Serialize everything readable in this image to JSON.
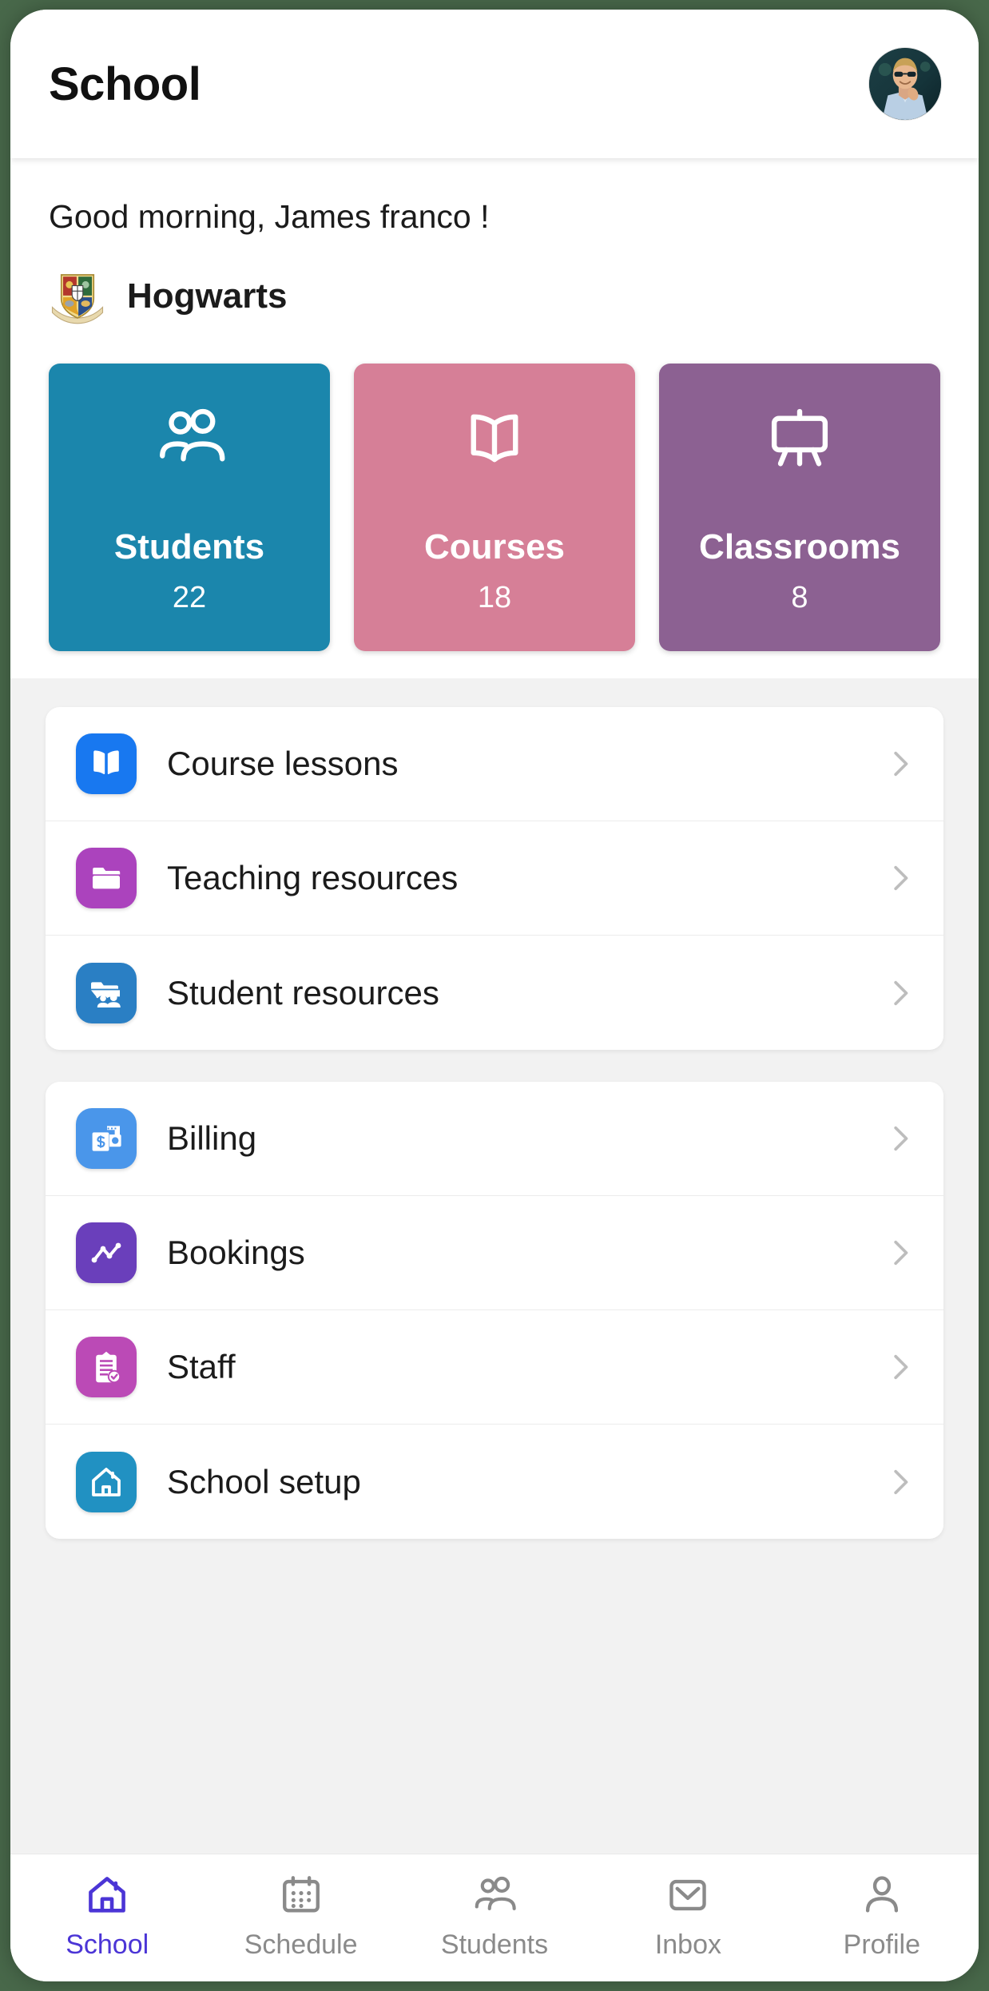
{
  "header": {
    "title": "School",
    "avatar_name": "user-avatar"
  },
  "greeting": {
    "text": "Good morning, James franco !"
  },
  "school": {
    "name": "Hogwarts",
    "logo_name": "hogwarts-crest"
  },
  "stats": [
    {
      "label": "Students",
      "value": "22",
      "color": "#1b86ac",
      "icon": "people-icon"
    },
    {
      "label": "Courses",
      "value": "18",
      "color": "#d67f97",
      "icon": "open-book-icon"
    },
    {
      "label": "Classrooms",
      "value": "8",
      "color": "#8c6192",
      "icon": "easel-icon"
    }
  ],
  "menu_cards": [
    {
      "items": [
        {
          "label": "Course lessons",
          "color": "#1878f0",
          "icon": "book-icon"
        },
        {
          "label": "Teaching resources",
          "color": "#ab43bd",
          "icon": "folder-icon"
        },
        {
          "label": "Student resources",
          "color": "#2a7fc4",
          "icon": "folder-people-icon"
        }
      ]
    },
    {
      "items": [
        {
          "label": "Billing",
          "color": "#4a96ea",
          "icon": "money-icon"
        },
        {
          "label": "Bookings",
          "color": "#6a3fbb",
          "icon": "line-chart-icon"
        },
        {
          "label": "Staff",
          "color": "#bb4ab6",
          "icon": "clipboard-check-icon"
        },
        {
          "label": "School setup",
          "color": "#2191c2",
          "icon": "house-icon"
        }
      ]
    }
  ],
  "tabs": [
    {
      "label": "School",
      "icon": "home-icon",
      "active": true
    },
    {
      "label": "Schedule",
      "icon": "calendar-icon",
      "active": false
    },
    {
      "label": "Students",
      "icon": "people-icon",
      "active": false
    },
    {
      "label": "Inbox",
      "icon": "envelope-icon",
      "active": false
    },
    {
      "label": "Profile",
      "icon": "person-icon",
      "active": false
    }
  ],
  "colors": {
    "page_background": "#48684a",
    "card_gap_background": "#f2f2f2",
    "active_tab": "#4b35d6",
    "inactive_tab": "#8a8a8a",
    "chevron": "#bdbdbd"
  }
}
